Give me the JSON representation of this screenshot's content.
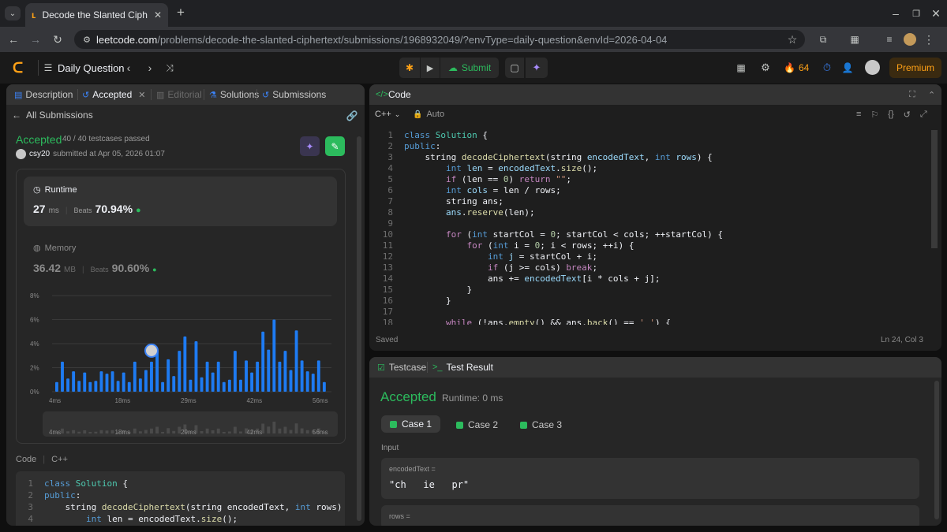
{
  "browser": {
    "tab_title": "Decode the Slanted Ciphe",
    "url_host": "leetcode.com",
    "url_path": "/problems/decode-the-slanted-ciphertext/submissions/1968932049/?envType=daily-question&envId=2026-04-04"
  },
  "nav": {
    "daily_label": "Daily Question",
    "submit_label": "Submit",
    "streak": "64",
    "premium_label": "Premium"
  },
  "left": {
    "tabs": [
      "Description",
      "Accepted",
      "Editorial",
      "Solutions",
      "Submissions"
    ],
    "back_label": "All Submissions",
    "status": "Accepted",
    "testcases": "40 / 40 testcases passed",
    "user": "csy20",
    "submitted_at": "submitted at Apr 05, 2026 01:07",
    "runtime_label": "Runtime",
    "runtime_value": "27",
    "runtime_unit": "ms",
    "beats_label": "Beats",
    "runtime_beats": "70.94%",
    "memory_label": "Memory",
    "memory_value": "36.42",
    "memory_unit": "MB",
    "memory_beats": "90.60%",
    "code_label": "Code",
    "code_lang": "C++"
  },
  "chart_data": {
    "type": "bar",
    "y_ticks": [
      "8%",
      "6%",
      "4%",
      "2%",
      "0%"
    ],
    "x_ticks": [
      "4ms",
      "18ms",
      "29ms",
      "42ms",
      "56ms"
    ],
    "ylim": [
      0,
      8
    ],
    "values": [
      0.8,
      2.5,
      1.1,
      1.7,
      0.9,
      1.6,
      0.8,
      0.9,
      1.7,
      1.5,
      1.7,
      0.9,
      1.6,
      0.8,
      2.5,
      1.1,
      1.8,
      2.5,
      3.4,
      0.8,
      2.7,
      1.3,
      3.4,
      4.6,
      1.0,
      4.2,
      1.2,
      2.5,
      1.6,
      2.5,
      0.8,
      1.0,
      3.4,
      1.0,
      2.6,
      1.6,
      2.5,
      5.0,
      3.5,
      6.0,
      2.5,
      3.4,
      1.8,
      5.1,
      2.6,
      1.7,
      1.5,
      2.6,
      0.8
    ],
    "highlight_index": 17
  },
  "editor": {
    "title": "Code",
    "lang": "C++",
    "mode": "Auto",
    "saved": "Saved",
    "cursor": "Ln 24, Col 3"
  },
  "bottom": {
    "testcase_tab": "Testcase",
    "result_tab": "Test Result",
    "status": "Accepted",
    "runtime": "Runtime: 0 ms",
    "cases": [
      "Case 1",
      "Case 2",
      "Case 3"
    ],
    "input_label": "Input",
    "var1_name": "encodedText =",
    "var1_value": "\"ch   ie   pr\"",
    "var2_name": "rows ="
  }
}
